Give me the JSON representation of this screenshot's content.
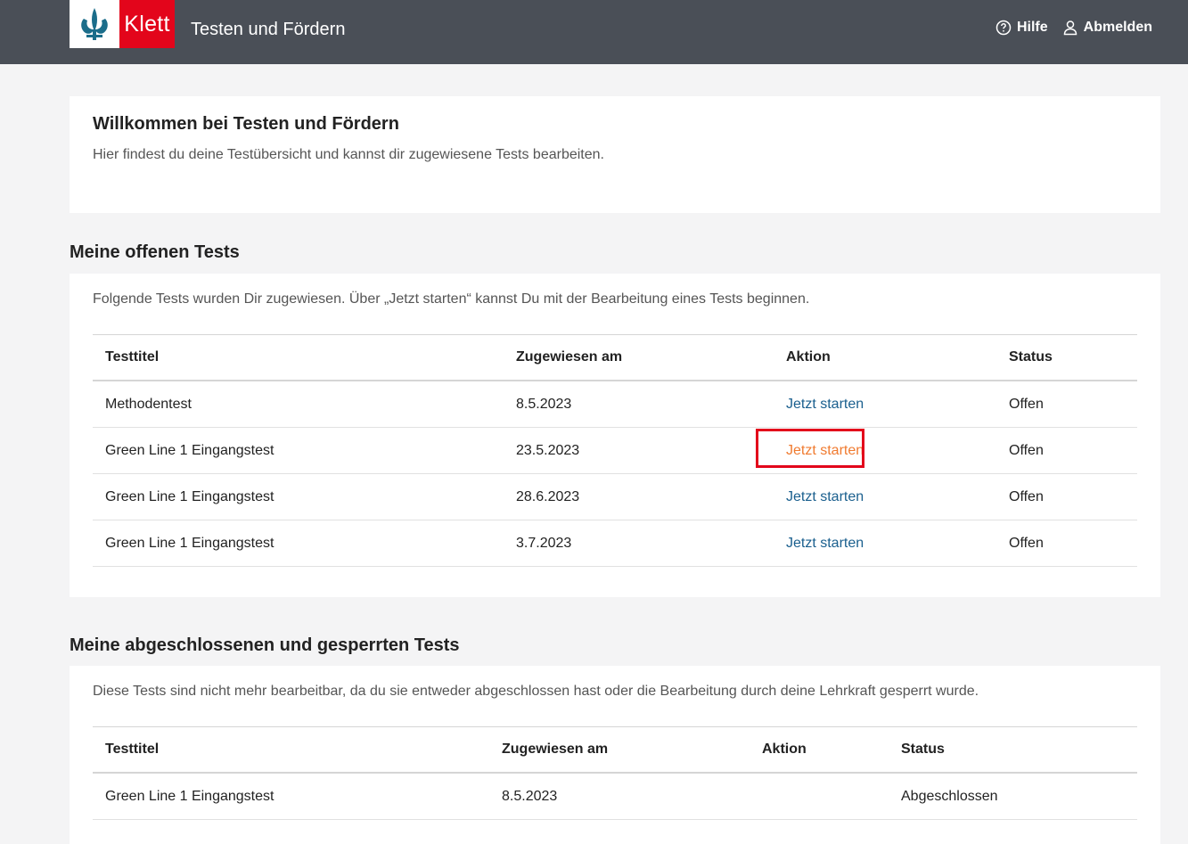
{
  "header": {
    "logo_text": "Klett",
    "app_title": "Testen und Fördern",
    "help_label": "Hilfe",
    "logout_label": "Abmelden"
  },
  "welcome": {
    "title": "Willkommen bei Testen und Fördern",
    "text": "Hier findest du deine Testübersicht und kannst dir zugewiesene Tests bearbeiten."
  },
  "open_tests": {
    "title": "Meine offenen Tests",
    "description": "Folgende Tests wurden Dir zugewiesen. Über „Jetzt starten“ kannst Du mit der Bearbeitung eines Tests beginnen.",
    "columns": [
      "Testtitel",
      "Zugewiesen am",
      "Aktion",
      "Status"
    ],
    "rows": [
      {
        "title": "Methodentest",
        "date": "8.5.2023",
        "action": "Jetzt starten",
        "status": "Offen"
      },
      {
        "title": "Green Line 1 Eingangstest",
        "date": "23.5.2023",
        "action": "Jetzt starten",
        "status": "Offen"
      },
      {
        "title": "Green Line 1 Eingangstest",
        "date": "28.6.2023",
        "action": "Jetzt starten",
        "status": "Offen"
      },
      {
        "title": "Green Line 1 Eingangstest",
        "date": "3.7.2023",
        "action": "Jetzt starten",
        "status": "Offen"
      }
    ]
  },
  "closed_tests": {
    "title": "Meine abgeschlossenen und gesperrten Tests",
    "description": "Diese Tests sind nicht mehr bearbeitbar, da du sie entweder abgeschlossen hast oder die Bearbeitung durch deine Lehrkraft gesperrt wurde.",
    "columns": [
      "Testtitel",
      "Zugewiesen am",
      "Aktion",
      "Status"
    ],
    "rows": [
      {
        "title": "Green Line 1 Eingangstest",
        "date": "8.5.2023",
        "action": "",
        "status": "Abgeschlossen"
      }
    ]
  },
  "colors": {
    "header_bg": "#4a4f57",
    "brand_red": "#e3051b",
    "link_blue": "#1a5f8e",
    "link_hover_orange": "#f07b30"
  },
  "icons": {
    "help": "question-circle-icon",
    "logout": "user-icon",
    "logo": "klett-lily-icon"
  }
}
